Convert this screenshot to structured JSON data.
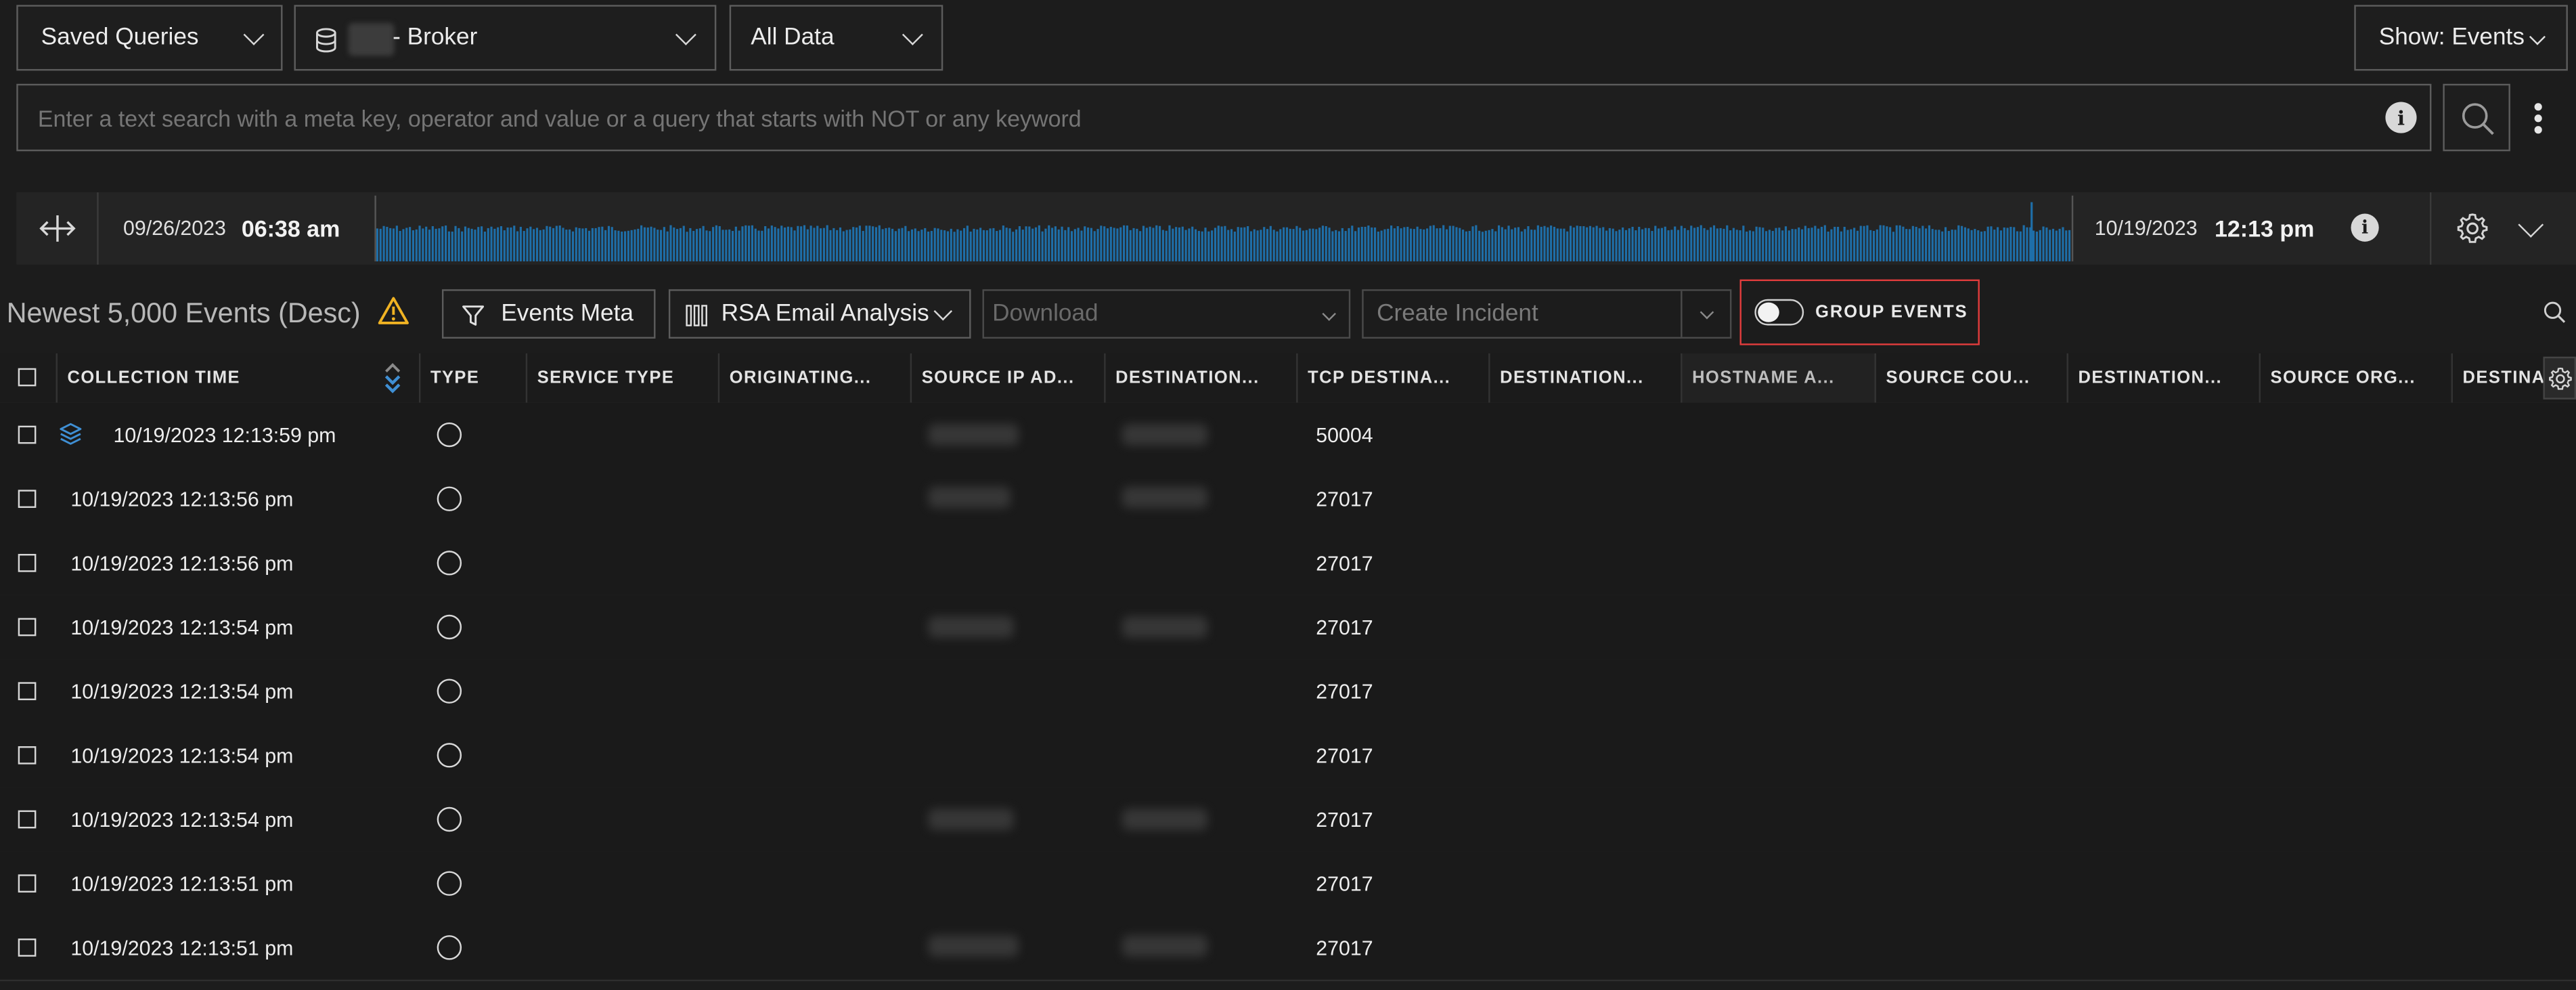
{
  "toolbar": {
    "saved_queries_label": "Saved Queries",
    "service_label": "- Broker",
    "data_range_label": "All Data",
    "show_label": "Show: Events"
  },
  "search": {
    "placeholder": "Enter a text search with a meta key, operator and value or a query that starts with NOT or any keyword"
  },
  "timeline": {
    "start_date": "09/26/2023",
    "start_time": "06:38 am",
    "end_date": "10/19/2023",
    "end_time": "12:13 pm",
    "bar_color": "#1e6ea8"
  },
  "events_bar": {
    "title": "Newest 5,000 Events (Desc)",
    "events_meta_label": "Events Meta",
    "profile_label": "RSA Email Analysis",
    "download_placeholder": "Download",
    "create_incident_placeholder": "Create Incident",
    "group_events_label": "GROUP EVENTS",
    "highlight_color": "#e03c3c",
    "warning_color": "#f0b323"
  },
  "columns": [
    "COLLECTION TIME",
    "TYPE",
    "SERVICE TYPE",
    "ORIGINATING...",
    "SOURCE IP AD...",
    "DESTINATION...",
    "TCP DESTINA...",
    "DESTINATION...",
    "HOSTNAME A...",
    "SOURCE COU...",
    "DESTINATION...",
    "SOURCE ORG...",
    "DESTINA"
  ],
  "rows": [
    {
      "time": "10/19/2023 12:13:59 pm",
      "port": "50004"
    },
    {
      "time": "10/19/2023 12:13:56 pm",
      "port": "27017"
    },
    {
      "time": "10/19/2023 12:13:56 pm",
      "port": "27017"
    },
    {
      "time": "10/19/2023 12:13:54 pm",
      "port": "27017"
    },
    {
      "time": "10/19/2023 12:13:54 pm",
      "port": "27017"
    },
    {
      "time": "10/19/2023 12:13:54 pm",
      "port": "27017"
    },
    {
      "time": "10/19/2023 12:13:54 pm",
      "port": "27017"
    },
    {
      "time": "10/19/2023 12:13:51 pm",
      "port": "27017"
    },
    {
      "time": "10/19/2023 12:13:51 pm",
      "port": "27017"
    }
  ]
}
